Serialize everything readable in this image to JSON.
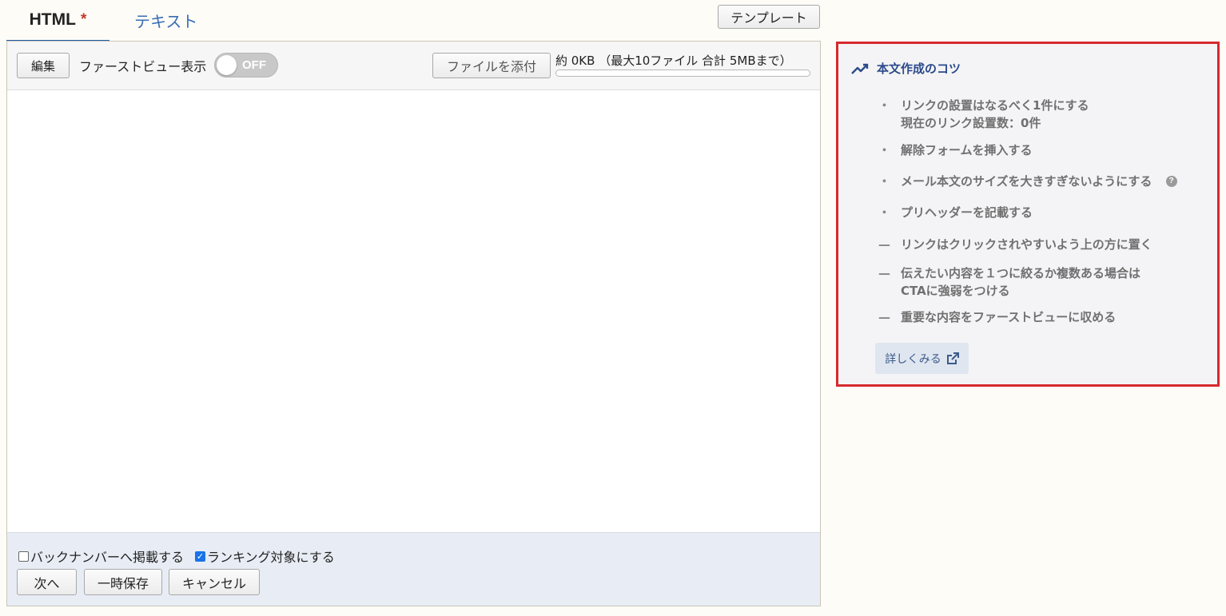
{
  "tabs": {
    "html_label": "HTML",
    "html_marker": "*",
    "text_label": "テキスト"
  },
  "template_button": "テンプレート",
  "toolbar": {
    "edit_label": "編集",
    "first_view_label": "ファーストビュー表示",
    "toggle_state": "OFF",
    "attach_label": "ファイルを添付",
    "size_info": "約 0KB （最大10ファイル 合計 5MBまで）",
    "size_usage_percent": 0
  },
  "footer": {
    "backnumber_label": "バックナンバーへ掲載する",
    "backnumber_checked": false,
    "ranking_label": "ランキング対象にする",
    "ranking_checked": true,
    "next_label": "次へ",
    "save_label": "一時保存",
    "cancel_label": "キャンセル"
  },
  "tips": {
    "title": "本文作成のコツ",
    "items": [
      {
        "mark": "・",
        "line1": "リンクの設置はなるべく1件にする",
        "line2": "現在のリンク設置数：0件"
      },
      {
        "mark": "・",
        "line1": "解除フォームを挿入する"
      },
      {
        "mark": "・",
        "line1": "メール本文のサイズを大きすぎないようにする",
        "help": "?"
      },
      {
        "mark": "・",
        "line1": "プリヘッダーを記載する"
      },
      {
        "mark": "—",
        "line1": "リンクはクリックされやすいよう上の方に置く"
      },
      {
        "mark": "—",
        "line1": "伝えたい内容を１つに絞るか複数ある場合は",
        "line2": "CTAに強弱をつける"
      },
      {
        "mark": "—",
        "line1": "重要な内容をファーストビューに収める"
      }
    ],
    "more_label": "詳しくみる"
  },
  "colors": {
    "accent": "#1f5da8",
    "tips_border": "#d62a2f",
    "tips_title": "#2c4a8a",
    "required_star": "#c0392b",
    "footer_bg": "#e8edf5"
  }
}
